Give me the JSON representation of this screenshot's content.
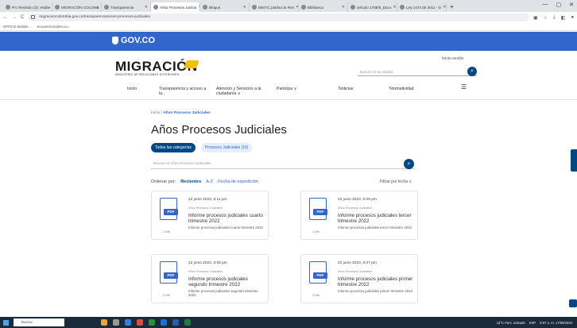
{
  "browser": {
    "tabs": [
      {
        "label": "Pn: Revisión (2): ertabe",
        "active": false
      },
      {
        "label": "MIGRACIÓN COLOMB",
        "active": false
      },
      {
        "label": "Transparencia",
        "active": false
      },
      {
        "label": "Años Procesos Judicia",
        "active": true
      },
      {
        "label": "Blogus",
        "active": false
      },
      {
        "label": "MinTIC publica la Res",
        "active": false
      },
      {
        "label": "Biblioteca",
        "active": false
      },
      {
        "label": "articulo 1758/8_Docu",
        "active": false
      },
      {
        "label": "Ley 1474 de 2011 - G",
        "active": false
      }
    ],
    "url": "migracioncolombia.gov.co/transparencia/anos-procesos-judiciales",
    "bookmarks": [
      "OFFICE Mobile...",
      "encuentrocodes.co..."
    ]
  },
  "gov": {
    "logo": "GOV.CO"
  },
  "header": {
    "logo_text": "MIGRACIÓN",
    "logo_sub": "MINISTERIO DE RELACIONES EXTERIORES",
    "login": "Inicio sesión",
    "search_placeholder": "Buscar en la entidad"
  },
  "nav": {
    "items": [
      "Inicio",
      "Transparencia y acceso a la...",
      "Atención y Servicios a la ciudadanía ∨",
      "Participa ∨",
      "Noticias",
      "Normatividad"
    ]
  },
  "breadcrumb": {
    "home": "Inicio",
    "current": "Años Procesos Judiciales"
  },
  "page": {
    "title": "Años Procesos Judiciales",
    "chip_all": "Todas las categorías",
    "chip_cat": "Procesos Judiciales (16)",
    "search_placeholder": "Buscar en Años Procesos Judiciales",
    "sort_label": "Ordenar por:",
    "sort_recent": "Recientes",
    "sort_az": "A-Z",
    "sort_date": "Fecha de expedición",
    "filter": "Filtrar por fecha ∨"
  },
  "cards": [
    {
      "date": "22 junio 2023, 5:11 pm",
      "category": "Años Procesos Judiciales",
      "title": "Informe procesos judiciales cuarto trimestre 2022",
      "desc": "Informe procesos judiciales cuarto trimestre 2022",
      "size": "1 Mb",
      "file_type": "PDF"
    },
    {
      "date": "22 junio 2023, 5:09 pm",
      "category": "Años Procesos Judiciales",
      "title": "Informe procesos judiciales tercer trimestre 2022",
      "desc": "Informe procesos judiciales tercer trimestre 2022",
      "size": "1 Mb",
      "file_type": "PDF"
    },
    {
      "date": "22 junio 2023, 5:08 pm",
      "category": "Años Procesos Judiciales",
      "title": "Informe procesos judiciales segundo trimestre 2022",
      "desc": "Informe procesos judiciales segundo trimestre 2022",
      "size": "2 Mb",
      "file_type": "PDF"
    },
    {
      "date": "22 junio 2023, 5:07 pm",
      "category": "Años Procesos Judiciales",
      "title": "Informe procesos judiciales primer trimestre 2022",
      "desc": "Informe procesos judiciales primer trimestre 2022",
      "size": "2 Mb",
      "file_type": "PDF"
    }
  ],
  "taskbar": {
    "search": "Buscar",
    "weather": "13°C Parc. soleado",
    "lang": "ESP",
    "time": "9:07 a. m.",
    "date": "17/08/2023"
  },
  "colors": {
    "gov_blue": "#3366cc",
    "dark_blue": "#004884"
  }
}
